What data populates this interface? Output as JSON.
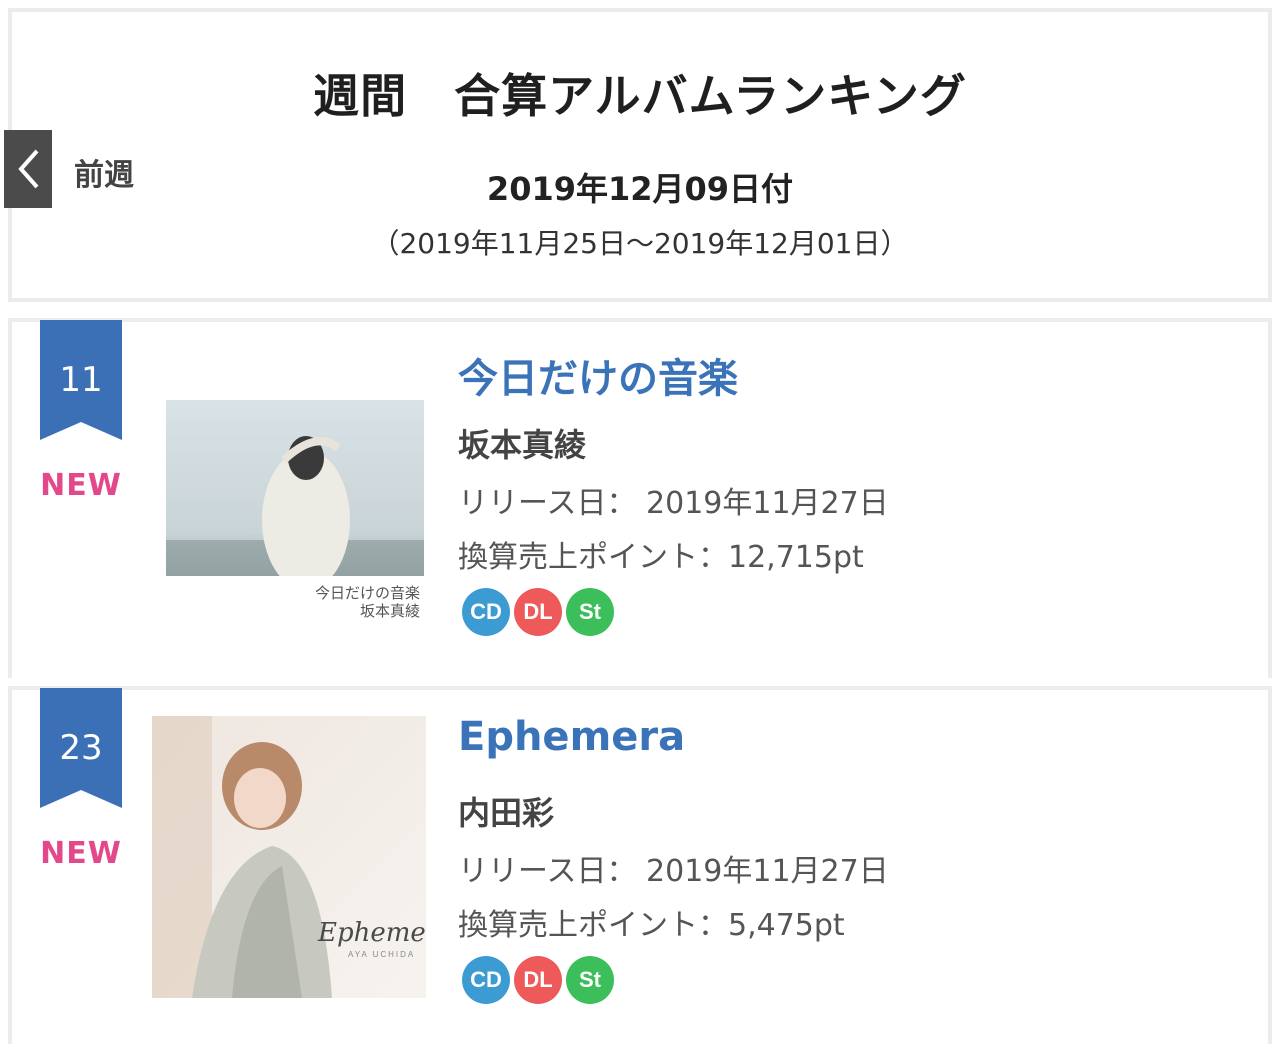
{
  "header": {
    "title": "週間　合算アルバムランキング",
    "prev_label": "前週",
    "chart_date": "2019年12月09日付",
    "period": "（2019年11月25日～2019年12月01日）"
  },
  "colors": {
    "ribbon": "#3b6fb6",
    "title_link": "#3b73b9",
    "new_badge": "#e2488a",
    "cd": "#3d9bd4",
    "dl": "#ee5a5a",
    "st": "#3cbf5a"
  },
  "entries": [
    {
      "rank": "11",
      "badge": "NEW",
      "title": "今日だけの音楽",
      "artist": "坂本真綾",
      "release": "リリース日： 2019年11月27日",
      "points": "換算売上ポイント：12,715pt",
      "cover_text_1": "今日だけの音楽",
      "cover_text_2": "坂本真綾",
      "formats": [
        "CD",
        "DL",
        "St"
      ]
    },
    {
      "rank": "23",
      "badge": "NEW",
      "title": "Ephemera",
      "artist": "内田彩",
      "release": "リリース日： 2019年11月27日",
      "points": "換算売上ポイント：5,475pt",
      "cover_text_1": "Ephemera",
      "cover_text_2": "AYA UCHIDA",
      "formats": [
        "CD",
        "DL",
        "St"
      ]
    }
  ]
}
